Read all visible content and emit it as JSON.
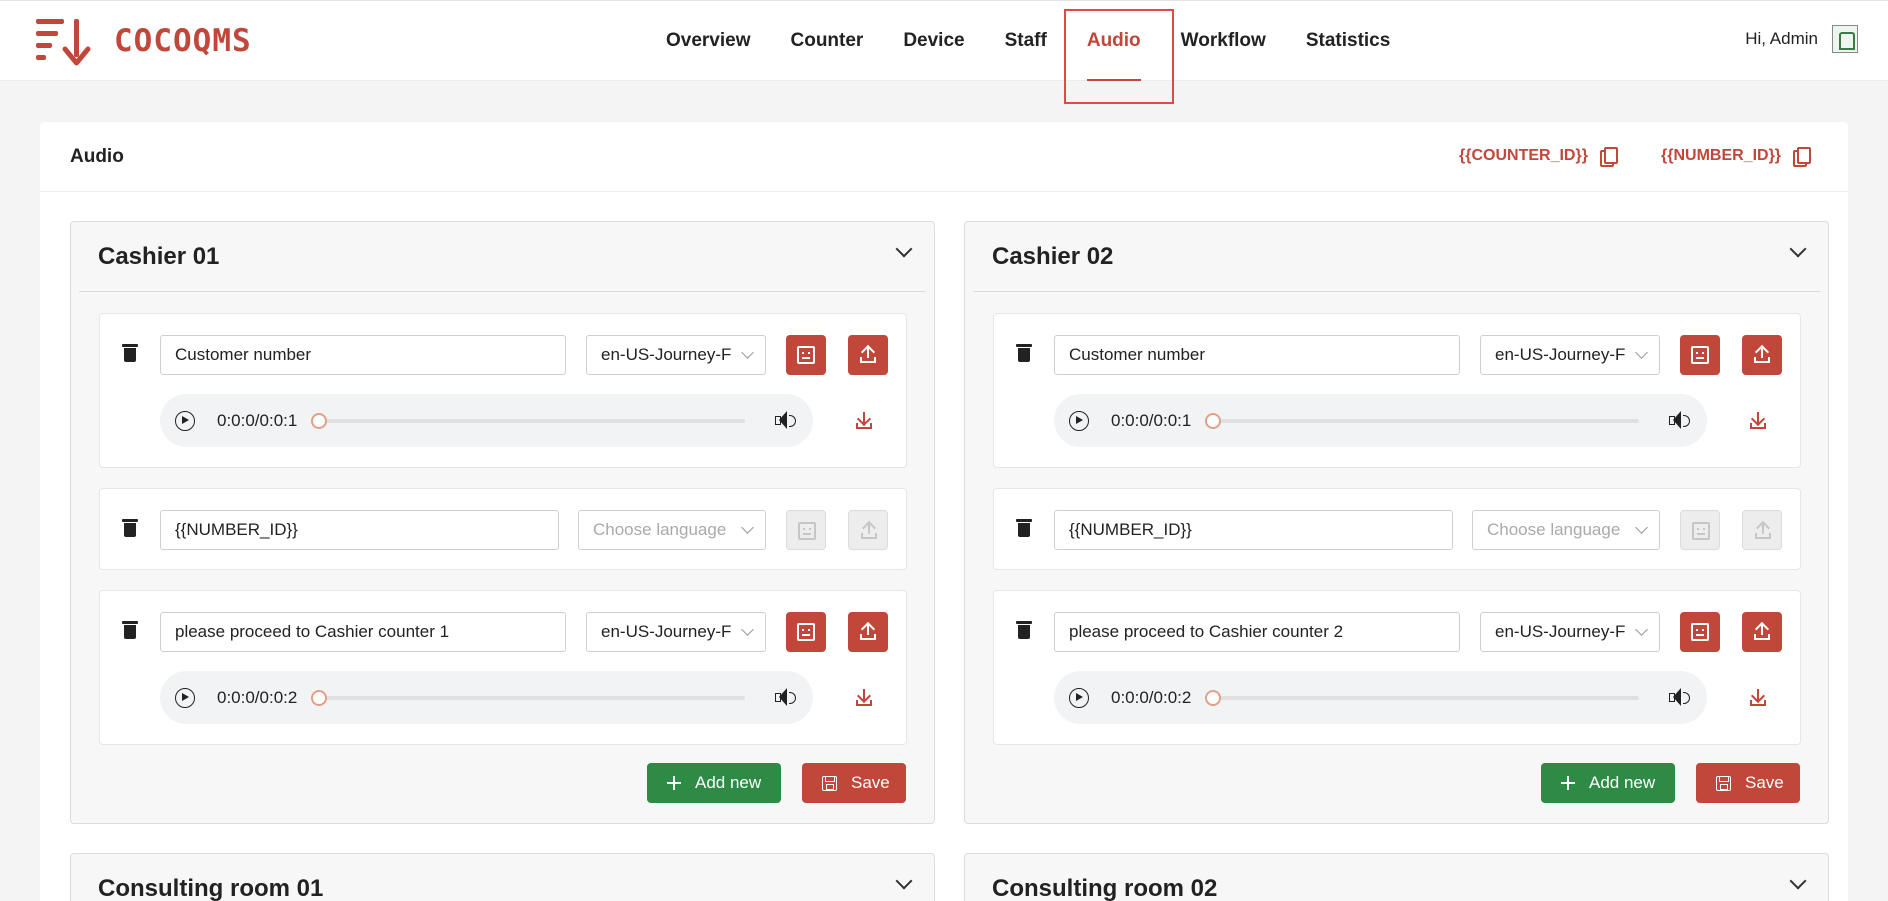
{
  "app": {
    "logo_text": "COCOQMS"
  },
  "nav": {
    "items": [
      {
        "label": "Overview"
      },
      {
        "label": "Counter"
      },
      {
        "label": "Device"
      },
      {
        "label": "Staff"
      },
      {
        "label": "Audio"
      },
      {
        "label": "Workflow"
      },
      {
        "label": "Statistics"
      }
    ],
    "active": "Audio"
  },
  "user": {
    "greeting": "Hi, Admin"
  },
  "page": {
    "title": "Audio",
    "variables": [
      "{{COUNTER_ID}}",
      "{{NUMBER_ID}}"
    ]
  },
  "panels": [
    {
      "title": "Cashier 01",
      "rows": [
        {
          "text": "Customer number",
          "language": "en-US-Journey-F",
          "time": "0:0:0/0:0:1"
        },
        {
          "text": "{{NUMBER_ID}}",
          "language_placeholder": "Choose language"
        },
        {
          "text": "please proceed to Cashier counter 1",
          "language": "en-US-Journey-F",
          "time": "0:0:0/0:0:2"
        }
      ],
      "add_label": "Add new",
      "save_label": "Save"
    },
    {
      "title": "Cashier 02",
      "rows": [
        {
          "text": "Customer number",
          "language": "en-US-Journey-F",
          "time": "0:0:0/0:0:1"
        },
        {
          "text": "{{NUMBER_ID}}",
          "language_placeholder": "Choose language"
        },
        {
          "text": "please proceed to Cashier counter 2",
          "language": "en-US-Journey-F",
          "time": "0:0:0/0:0:2"
        }
      ],
      "add_label": "Add new",
      "save_label": "Save"
    },
    {
      "title": "Consulting room 01"
    },
    {
      "title": "Consulting room 02"
    }
  ],
  "colors": {
    "accent": "#c0473a",
    "success": "#2e8b45",
    "highlight": "#e04a46"
  }
}
